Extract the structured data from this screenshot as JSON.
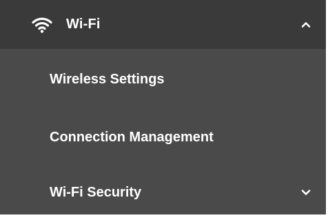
{
  "menu": {
    "title": "Wi-Fi",
    "icon": "wifi-icon",
    "expanded": true,
    "items": [
      {
        "label": "Wireless Settings",
        "has_submenu": false
      },
      {
        "label": "Connection Management",
        "has_submenu": false
      },
      {
        "label": "Wi-Fi Security",
        "has_submenu": true
      }
    ]
  },
  "colors": {
    "header_background": "#3a3a3a",
    "menu_background": "#4a4a4a",
    "text": "#ffffff"
  }
}
